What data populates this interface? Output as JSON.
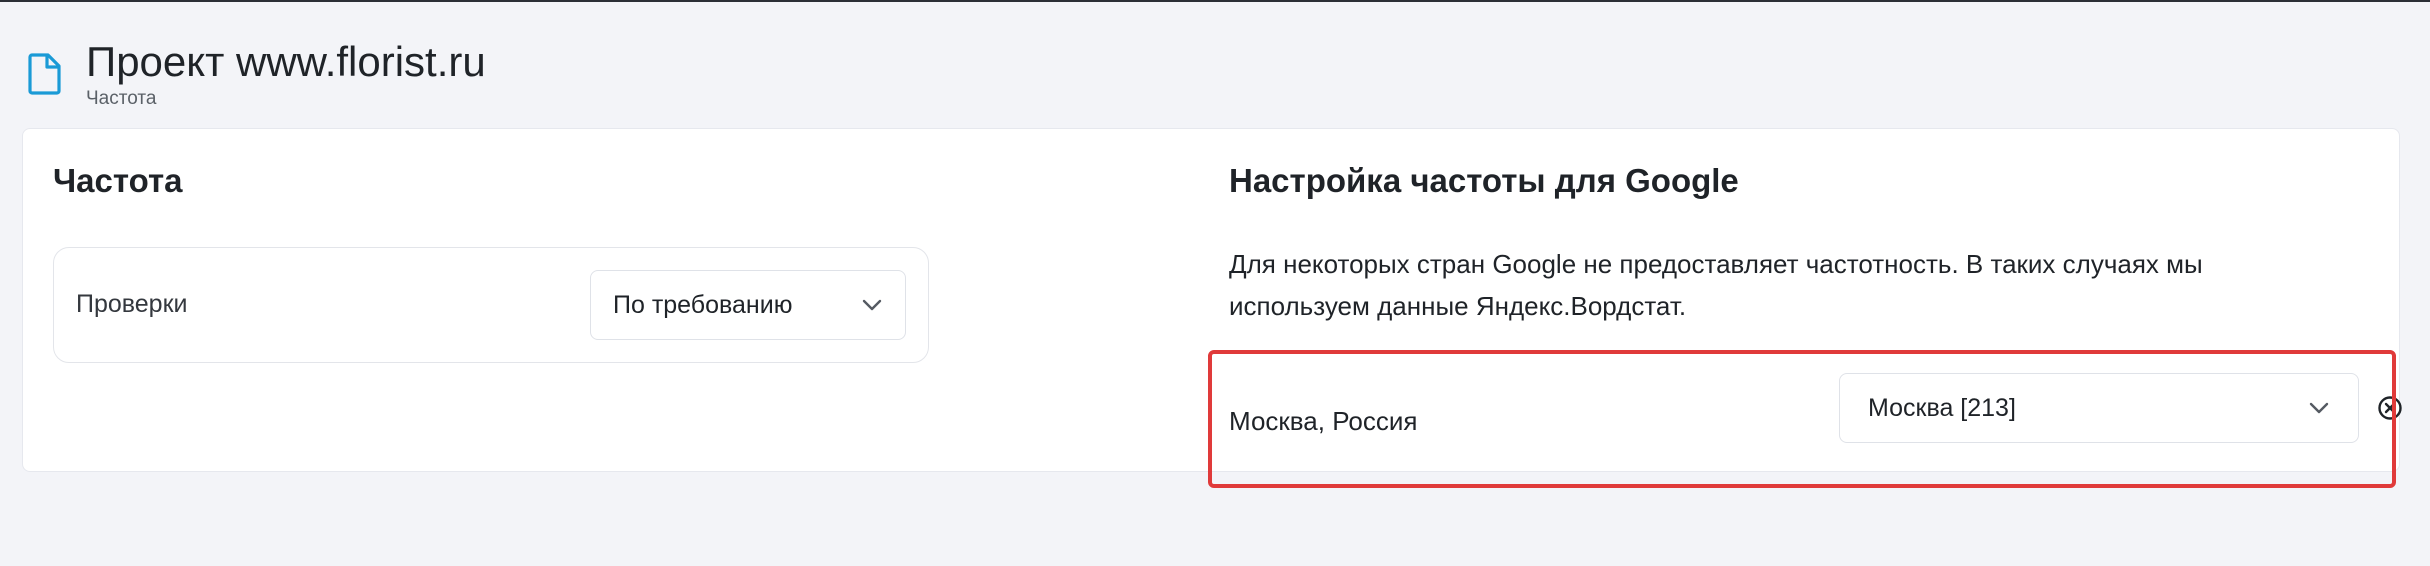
{
  "header": {
    "title": "Проект www.florist.ru",
    "subtitle": "Частота",
    "icon": "document-icon",
    "icon_color": "#1a9ad6"
  },
  "left": {
    "section_title": "Частота",
    "checks_label": "Проверки",
    "checks_value": "По требованию"
  },
  "right": {
    "section_title": "Настройка частоты для Google",
    "description": "Для некоторых стран Google не предоставляет частотность. В таких случаях мы используем данные Яндекс.Вордстат.",
    "mapping": {
      "region": "Москва, Россия",
      "value": "Москва [213]"
    }
  },
  "colors": {
    "background": "#f3f4f8",
    "card": "#ffffff",
    "highlight": "#e03a3a"
  }
}
